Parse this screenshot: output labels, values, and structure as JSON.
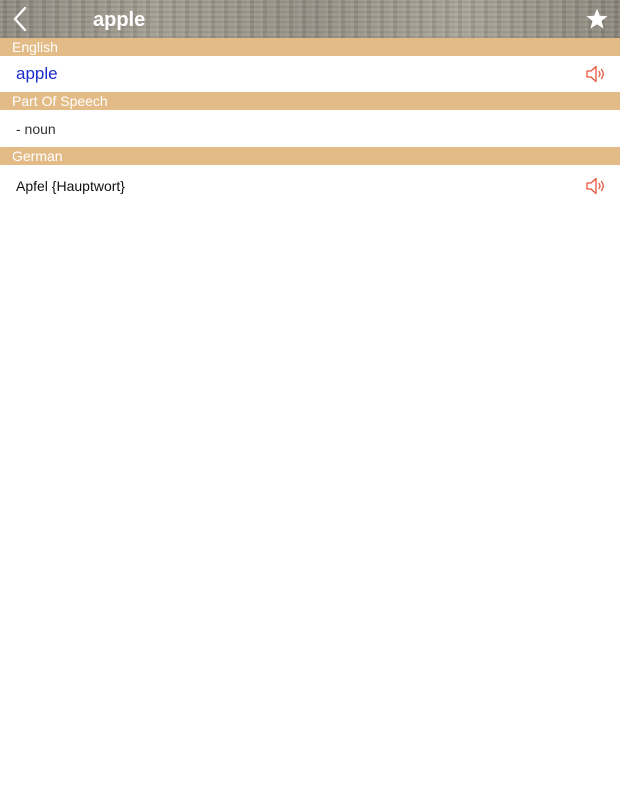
{
  "navbar": {
    "title": "apple",
    "back_icon": "chevron-left-icon",
    "favorite_icon": "star-icon"
  },
  "sections": {
    "english": {
      "header": "English",
      "word": "apple",
      "audio_icon": "speaker-icon"
    },
    "part_of_speech": {
      "header": "Part Of Speech",
      "value": "- noun"
    },
    "german": {
      "header": "German",
      "translation": "Apfel {Hauptwort}",
      "audio_icon": "speaker-icon"
    }
  },
  "colors": {
    "section_header_bg": "#e3bb86",
    "english_word": "#1a2bd0",
    "speaker_icon": "#e8553a"
  }
}
